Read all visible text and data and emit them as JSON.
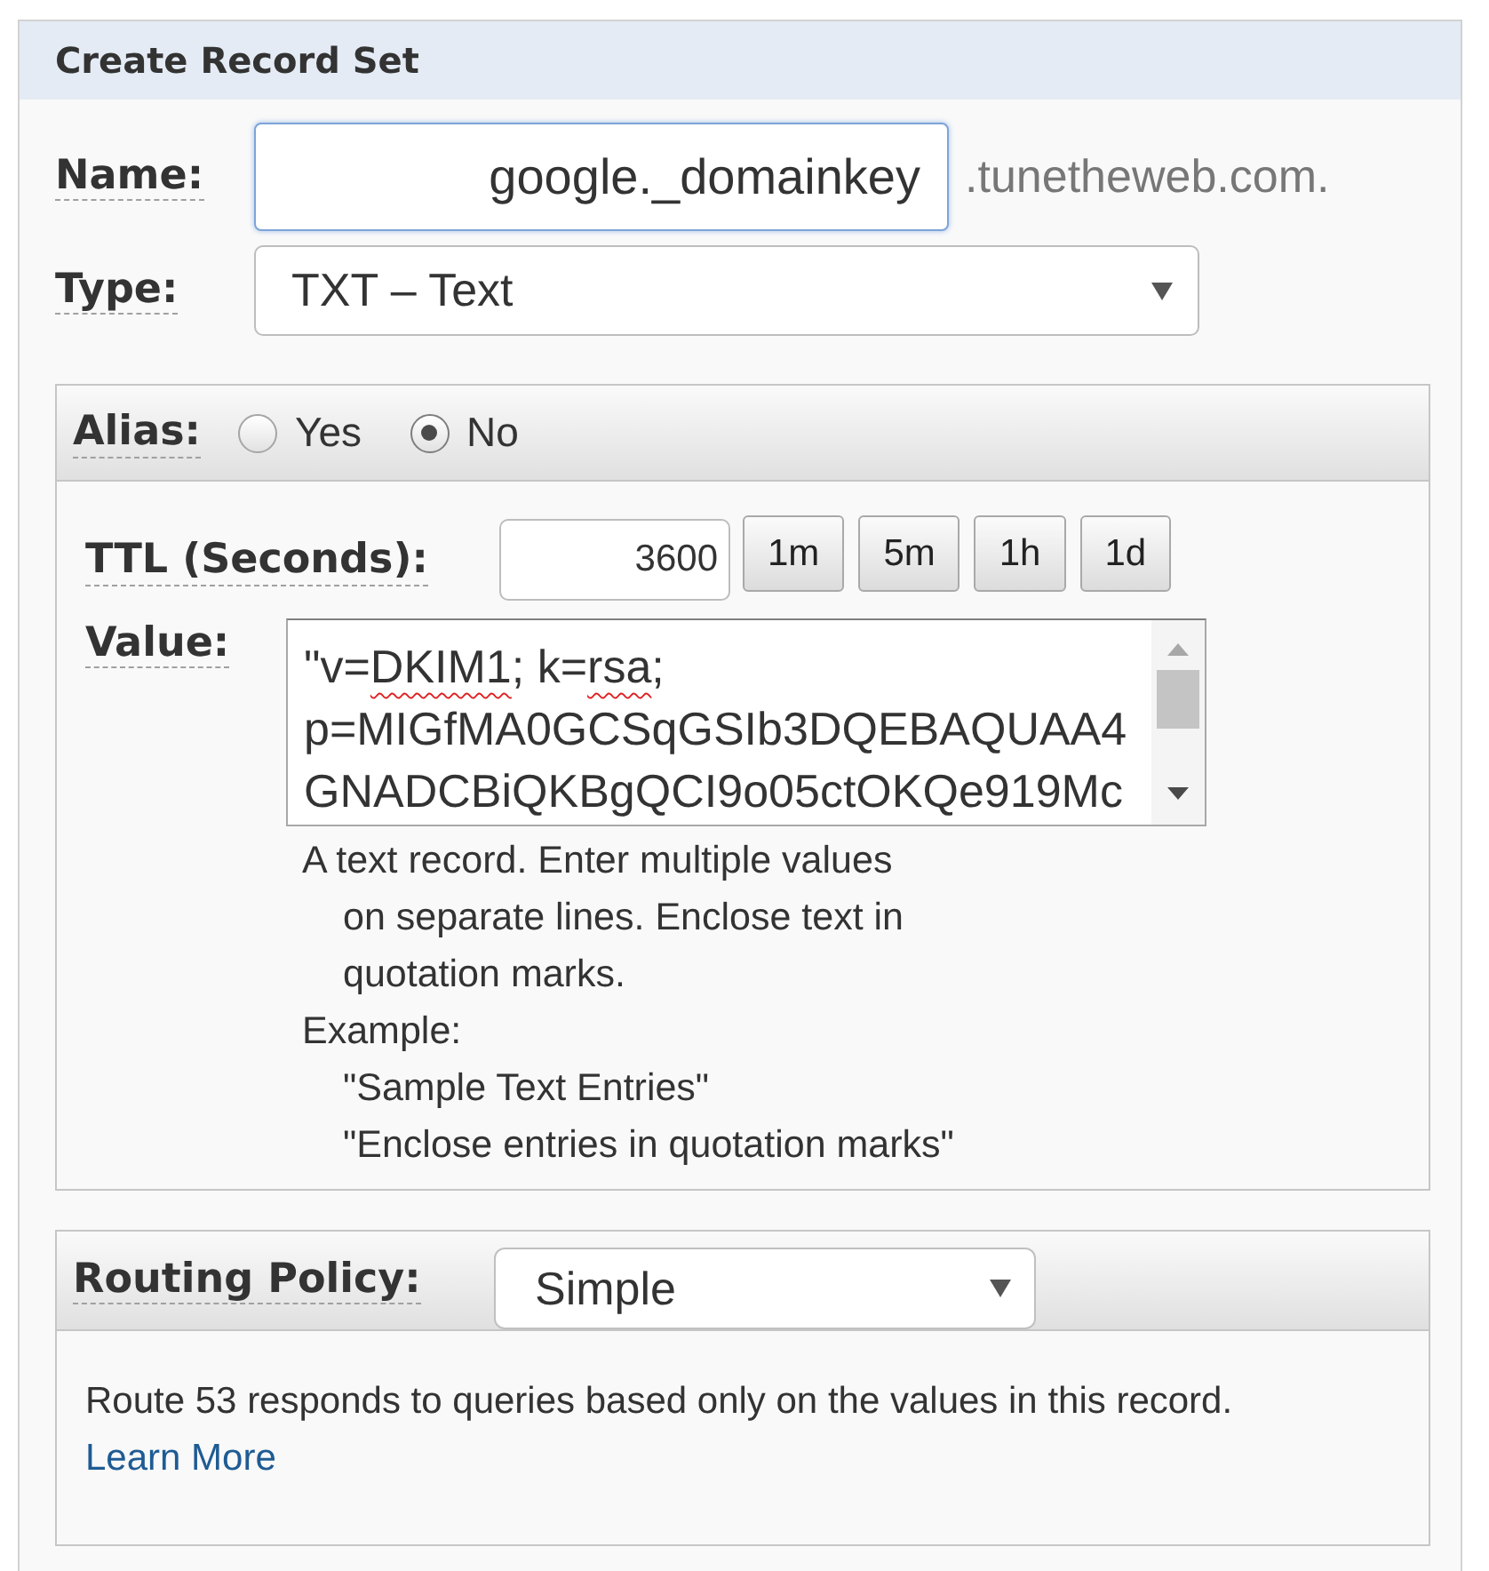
{
  "panel": {
    "title": "Create Record Set"
  },
  "name_field": {
    "label": "Name:",
    "value": "google._domainkey",
    "focused": true,
    "suffix": ".tunetheweb.com."
  },
  "type_field": {
    "label": "Type:",
    "value": "TXT – Text"
  },
  "alias": {
    "label": "Alias:",
    "options": [
      {
        "label": "Yes",
        "selected": false
      },
      {
        "label": "No",
        "selected": true
      }
    ]
  },
  "ttl": {
    "label": "TTL (Seconds):",
    "value": "3600",
    "presets": [
      "1m",
      "5m",
      "1h",
      "1d"
    ]
  },
  "value_field": {
    "label": "Value:",
    "lines": [
      [
        {
          "text": "\"v=",
          "misspelled": false
        },
        {
          "text": "DKIM1",
          "misspelled": true
        },
        {
          "text": "; k=",
          "misspelled": false
        },
        {
          "text": "rsa",
          "misspelled": true
        },
        {
          "text": ";",
          "misspelled": false
        }
      ],
      [
        {
          "text": "p=MIGfMA0GCSqGSIb3DQEBAQUAA4",
          "misspelled": false
        }
      ],
      [
        {
          "text": "GNADCBiQKBgQCI9o05ctOKQe919Mc",
          "misspelled": false
        }
      ]
    ]
  },
  "help": {
    "lines": [
      "A text record. Enter multiple values",
      "on separate lines. Enclose text in",
      "quotation marks."
    ],
    "example_label": "Example:",
    "examples": [
      "\"Sample Text Entries\"",
      "\"Enclose entries in quotation marks\""
    ]
  },
  "routing_policy": {
    "label": "Routing Policy:",
    "value": "Simple",
    "description": "Route 53 responds to queries based only on the values in this record.",
    "link": "Learn More"
  }
}
